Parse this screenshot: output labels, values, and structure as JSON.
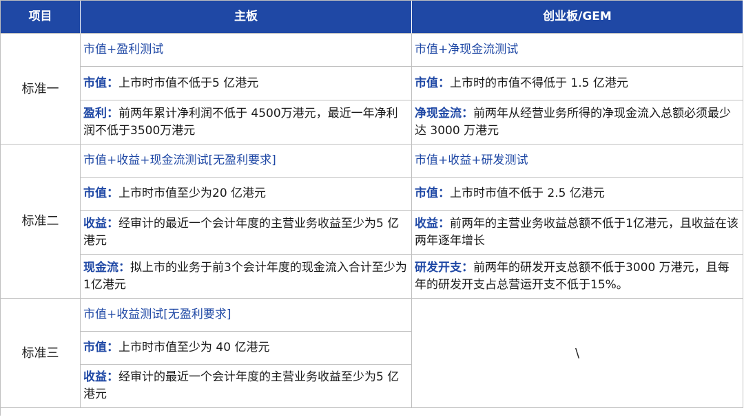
{
  "header": {
    "col1": "项目",
    "col2": "主板",
    "col3": "创业板/GEM"
  },
  "standards": [
    {
      "label": "标准一",
      "main": {
        "test": "市值+盈利测试",
        "rows": [
          {
            "key": "市值：",
            "text": "上市时市值不低于5 亿港元"
          },
          {
            "key": "盈利：",
            "text": "前两年累计净利润不低于 4500万港元，最近一年净利润不低于3500万港元"
          }
        ]
      },
      "gem": {
        "test": "市值+净现金流测试",
        "rows": [
          {
            "key": "市值：",
            "text": "上市时的市值不得低于 1.5 亿港元"
          },
          {
            "key": "净现金流：",
            "text": "前两年从经营业务所得的净现金流入总额必须最少达 3000 万港元"
          }
        ]
      }
    },
    {
      "label": "标准二",
      "main": {
        "test": "市值+收益+现金流测试[无盈利要求]",
        "rows": [
          {
            "key": "市值：",
            "text": "上市时市值至少为20 亿港元"
          },
          {
            "key": "收益：",
            "text": "经审计的最近一个会计年度的主营业务收益至少为5 亿港元"
          },
          {
            "key": "现金流：",
            "text": "拟上市的业务于前3个会计年度的现金流入合计至少为1亿港元"
          }
        ]
      },
      "gem": {
        "test": "市值+收益+研发测试",
        "rows": [
          {
            "key": "市值：",
            "text": "上市时市值不低于 2.5 亿港元"
          },
          {
            "key": "收益：",
            "text": "前两年的主营业务收益总额不低于1亿港元，且收益在该两年逐年增长"
          },
          {
            "key": "研发开支：",
            "text": "前两年的研发开支总额不低于3000 万港元，且每年的研发开支占总营运开支不低于15%。"
          }
        ]
      }
    },
    {
      "label": "标准三",
      "main": {
        "test": "市值+收益测试[无盈利要求]",
        "rows": [
          {
            "key": "市值：",
            "text": "上市时市值至少为 40 亿港元"
          },
          {
            "key": "收益：",
            "text": "经审计的最近一个会计年度的主营业务收益至少为5 亿港元"
          }
        ]
      },
      "gem": {
        "empty": "\\"
      }
    }
  ]
}
